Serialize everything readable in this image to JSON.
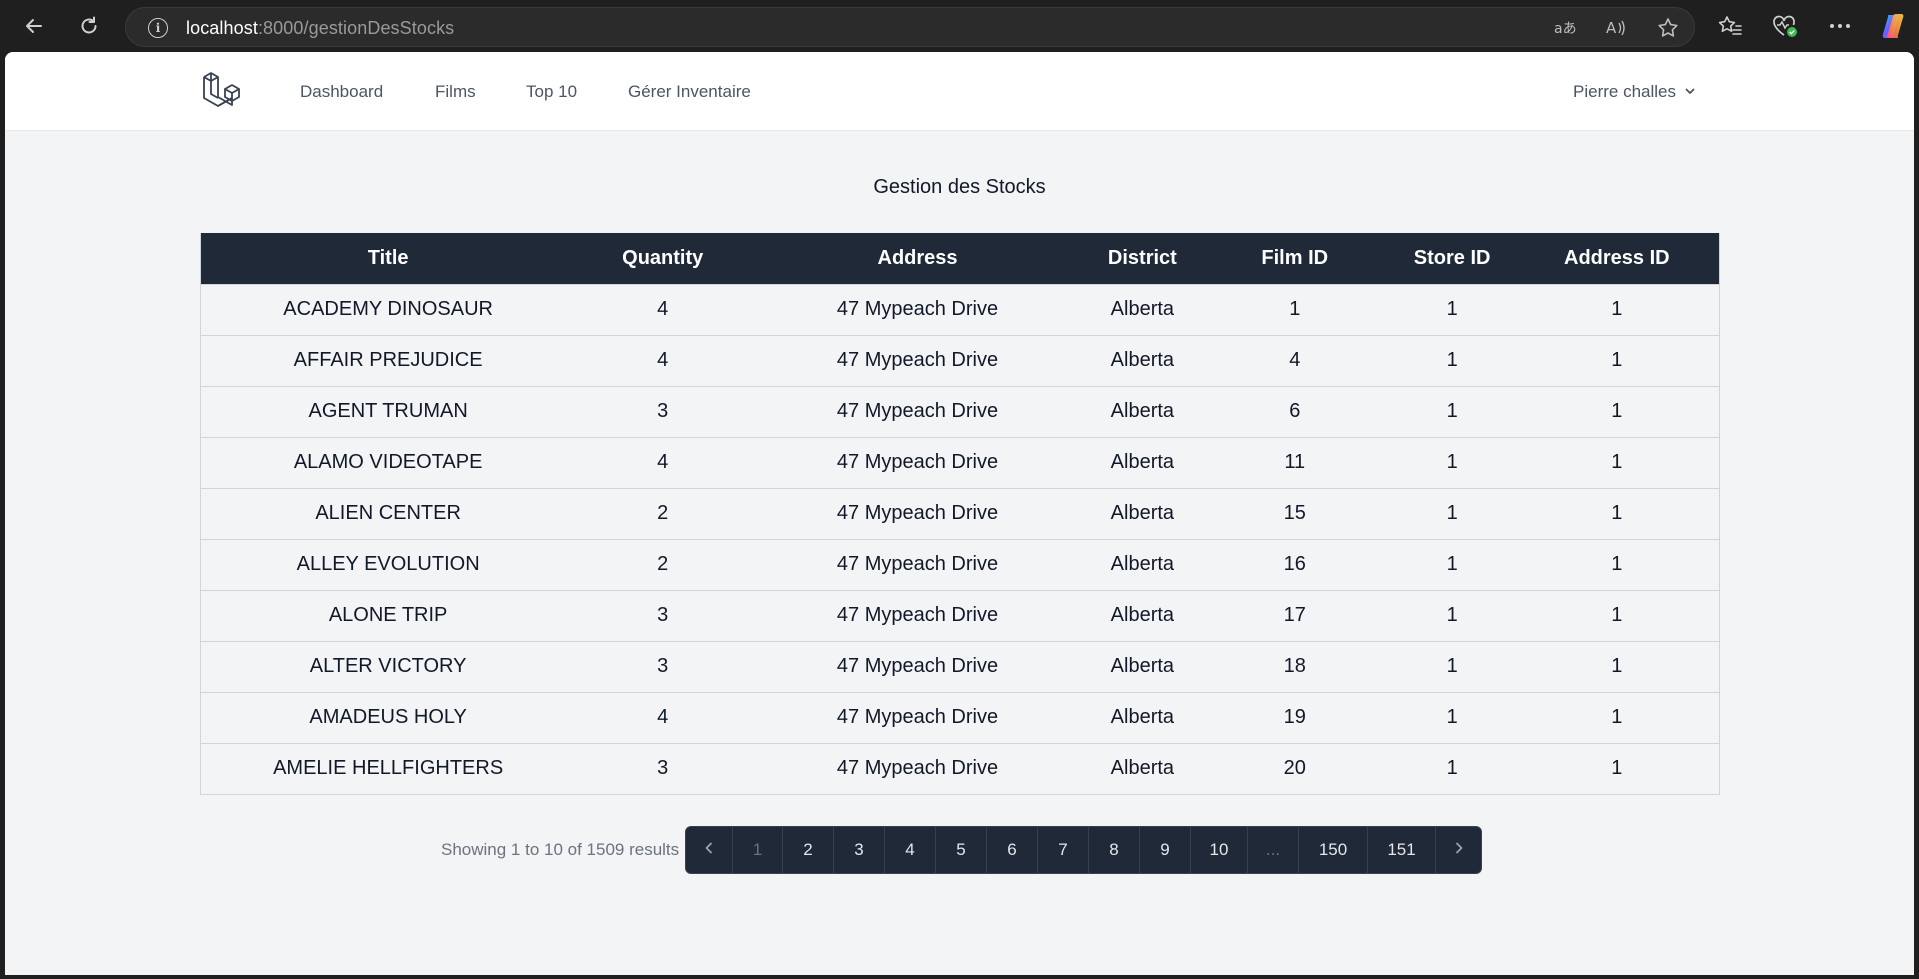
{
  "browser": {
    "url_host": "localhost",
    "url_path": ":8000/gestionDesStocks"
  },
  "nav": {
    "links": [
      "Dashboard",
      "Films",
      "Top 10",
      "Gérer Inventaire"
    ],
    "user": "Pierre challes"
  },
  "page": {
    "title": "Gestion des Stocks"
  },
  "table": {
    "headers": [
      "Title",
      "Quantity",
      "Address",
      "District",
      "Film ID",
      "Store ID",
      "Address ID"
    ],
    "rows": [
      [
        "ACADEMY DINOSAUR",
        "4",
        "47 Mypeach Drive",
        "Alberta",
        "1",
        "1",
        "1"
      ],
      [
        "AFFAIR PREJUDICE",
        "4",
        "47 Mypeach Drive",
        "Alberta",
        "4",
        "1",
        "1"
      ],
      [
        "AGENT TRUMAN",
        "3",
        "47 Mypeach Drive",
        "Alberta",
        "6",
        "1",
        "1"
      ],
      [
        "ALAMO VIDEOTAPE",
        "4",
        "47 Mypeach Drive",
        "Alberta",
        "11",
        "1",
        "1"
      ],
      [
        "ALIEN CENTER",
        "2",
        "47 Mypeach Drive",
        "Alberta",
        "15",
        "1",
        "1"
      ],
      [
        "ALLEY EVOLUTION",
        "2",
        "47 Mypeach Drive",
        "Alberta",
        "16",
        "1",
        "1"
      ],
      [
        "ALONE TRIP",
        "3",
        "47 Mypeach Drive",
        "Alberta",
        "17",
        "1",
        "1"
      ],
      [
        "ALTER VICTORY",
        "3",
        "47 Mypeach Drive",
        "Alberta",
        "18",
        "1",
        "1"
      ],
      [
        "AMADEUS HOLY",
        "4",
        "47 Mypeach Drive",
        "Alberta",
        "19",
        "1",
        "1"
      ],
      [
        "AMELIE HELLFIGHTERS",
        "3",
        "47 Mypeach Drive",
        "Alberta",
        "20",
        "1",
        "1"
      ]
    ]
  },
  "pagination": {
    "summary": "Showing 1 to 10 of 1509 results",
    "pages": [
      "1",
      "2",
      "3",
      "4",
      "5",
      "6",
      "7",
      "8",
      "9",
      "10",
      "...",
      "150",
      "151"
    ]
  }
}
